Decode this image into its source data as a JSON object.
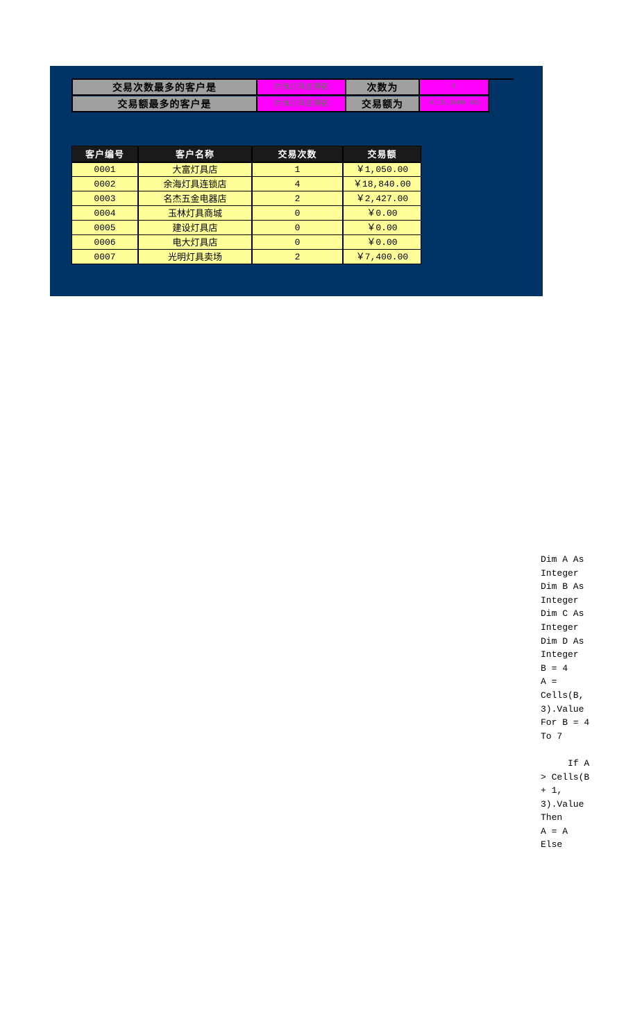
{
  "panel": {
    "background_color": "#003366"
  },
  "summary": {
    "rows": [
      {
        "label": "交易次数最多的客户是",
        "customer": "余海灯具连锁店",
        "sublabel": "次数为",
        "value": "4"
      },
      {
        "label": "交易额最多的客户是",
        "customer": "余海灯具连锁店",
        "sublabel": "交易额为",
        "value": "￥18,840.00"
      }
    ],
    "label_bg_color": "#a0a0a0",
    "value_bg_color": "#ff00ff"
  },
  "table": {
    "headers": [
      "客户编号",
      "客户名称",
      "交易次数",
      "交易额"
    ],
    "header_bg_color": "#1a1a1a",
    "row_bg_color": "#ffff99",
    "rows": [
      {
        "id": "0001",
        "name": "大富灯具店",
        "count": "1",
        "amount": "￥1,050.00"
      },
      {
        "id": "0002",
        "name": "余海灯具连锁店",
        "count": "4",
        "amount": "￥18,840.00"
      },
      {
        "id": "0003",
        "name": "名杰五金电器店",
        "count": "2",
        "amount": "￥2,427.00"
      },
      {
        "id": "0004",
        "name": "玉林灯具商城",
        "count": "0",
        "amount": "￥0.00"
      },
      {
        "id": "0005",
        "name": "建设灯具店",
        "count": "0",
        "amount": "￥0.00"
      },
      {
        "id": "0006",
        "name": "电大灯具店",
        "count": "0",
        "amount": "￥0.00"
      },
      {
        "id": "0007",
        "name": "光明灯具卖场",
        "count": "2",
        "amount": "￥7,400.00"
      }
    ]
  },
  "code_overflow": {
    "text": "Dim A As Integer     Dim B As Integer     Dim C As Integer     Dim D As Integer     B = 4     A = Cells(B, 3).Value     For B = 4 To 7\n\n     If A > Cells(B + 1, 3).Value Then     A = A     Else"
  }
}
